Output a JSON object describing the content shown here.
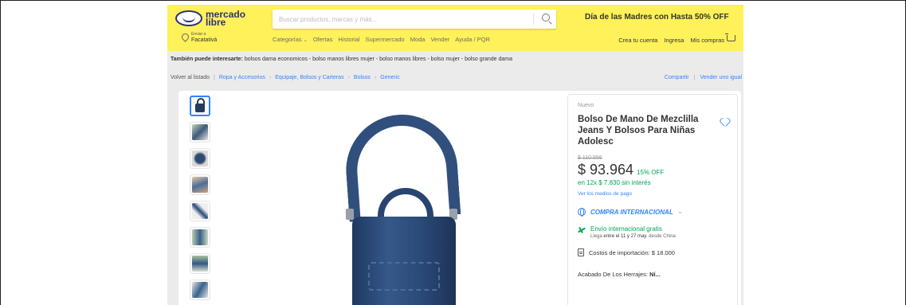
{
  "header": {
    "logo_text_1": "mercado",
    "logo_text_2": "libre",
    "search_placeholder": "Buscar productos, marcas y más...",
    "promo": "Día de las Madres con Hasta 50% OFF",
    "location_label": "Enviar a",
    "location_value": "Facatativá",
    "nav": [
      "Categorías",
      "Ofertas",
      "Historial",
      "Supermercado",
      "Moda",
      "Vender",
      "Ayuda / PQR"
    ],
    "account": [
      "Crea tu cuenta",
      "Ingresa",
      "Mis compras"
    ]
  },
  "related": {
    "label": "También puede interesarte:",
    "items": "bolsos dama economicos - bolso manos libres mujer - bolso manos libres - bolso mujer - bolso grande dama"
  },
  "breadcrumb": {
    "back": "Volver al listado",
    "items": [
      "Ropa y Accesorios",
      "Equipaje, Bolsos y Carteras",
      "Bolsos",
      "Generic"
    ]
  },
  "actions": {
    "share": "Compartir",
    "sell": "Vender uno igual"
  },
  "product": {
    "condition": "Nuevo",
    "title": "Bolso De Mano De Mezclilla Jeans Y Bolsos Para Niñas Adolesc",
    "old_price": "$ 110.556",
    "price": "$ 93.964",
    "discount": "15% OFF",
    "installments": "en 12x $ 7.830 sin interés",
    "payment_link": "Ver los medios de pago",
    "international": "COMPRA INTERNACIONAL",
    "shipping_title": "Envío internacional gratis",
    "shipping_prefix": "Llega",
    "shipping_dates": "entre el 11 y 27 may.",
    "shipping_origin": "desde China",
    "import_costs": "Costos de importación: $ 18.000",
    "attribute_label": "Acabado De Los Herrajes:",
    "attribute_value": "Ní..."
  },
  "colors": {
    "header_bg": "#fff159",
    "link": "#3483fa",
    "green": "#00a650"
  }
}
